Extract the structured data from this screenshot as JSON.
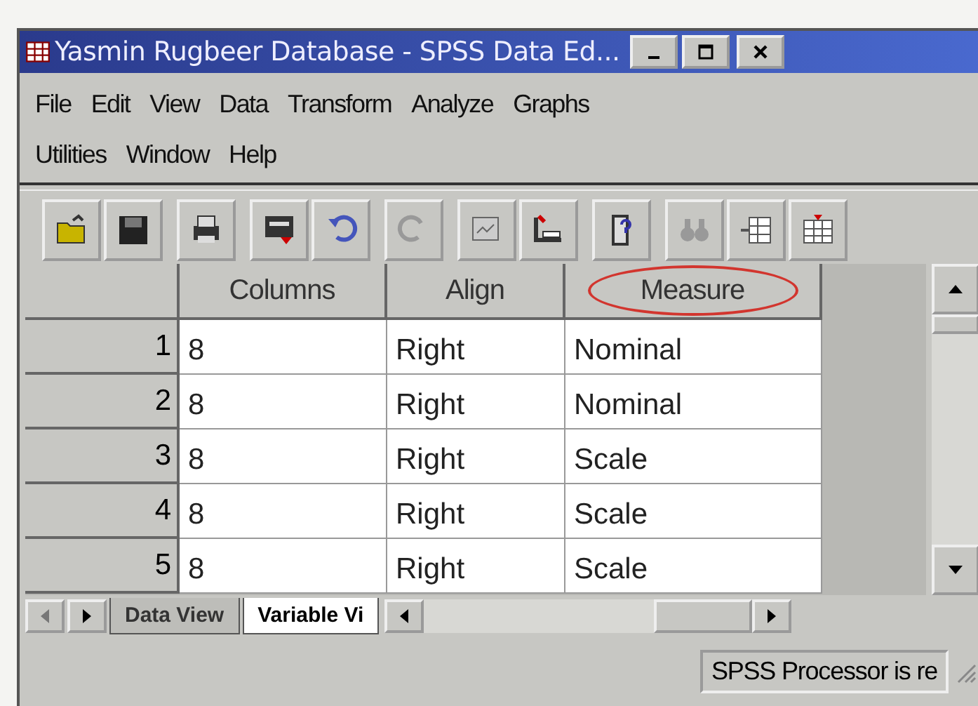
{
  "window": {
    "title": "Yasmin Rugbeer Database  - SPSS Data Ed..."
  },
  "menu": [
    "File",
    "Edit",
    "View",
    "Data",
    "Transform",
    "Analyze",
    "Graphs",
    "Utilities",
    "Window",
    "Help"
  ],
  "table": {
    "columns": [
      {
        "label": "Columns",
        "circled": false
      },
      {
        "label": "Align",
        "circled": false
      },
      {
        "label": "Measure",
        "circled": true
      }
    ],
    "rows": [
      {
        "number": "1",
        "cells": [
          "8",
          "Right",
          "Nominal"
        ]
      },
      {
        "number": "2",
        "cells": [
          "8",
          "Right",
          "Nominal"
        ]
      },
      {
        "number": "3",
        "cells": [
          "8",
          "Right",
          "Scale"
        ]
      },
      {
        "number": "4",
        "cells": [
          "8",
          "Right",
          "Scale"
        ]
      },
      {
        "number": "5",
        "cells": [
          "8",
          "Right",
          "Scale"
        ]
      }
    ]
  },
  "tabs": [
    {
      "label": "Data View",
      "selected": false
    },
    {
      "label": "Variable Vi",
      "selected": true
    }
  ],
  "status_bar": "SPSS Processor  is re"
}
